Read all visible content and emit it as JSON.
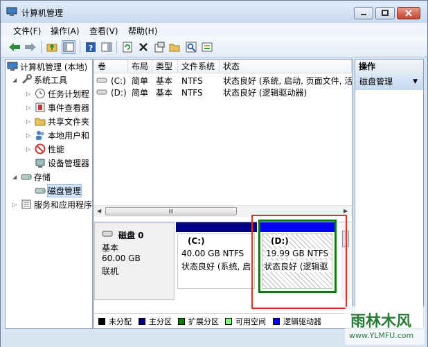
{
  "window": {
    "title": "计算机管理"
  },
  "menu": [
    "文件(F)",
    "操作(A)",
    "查看(V)",
    "帮助(H)"
  ],
  "tree": {
    "root": "计算机管理 (本地)",
    "system_tools": "系统工具",
    "items": [
      "任务计划程",
      "事件查看器",
      "共享文件夹",
      "本地用户和",
      "性能",
      "设备管理器"
    ],
    "storage": "存储",
    "disk_mgmt": "磁盘管理",
    "services": "服务和应用程序"
  },
  "volumes": {
    "columns": [
      "卷",
      "布局",
      "类型",
      "文件系统",
      "状态"
    ],
    "rows": [
      {
        "vol": "(C:)",
        "layout": "简单",
        "type": "基本",
        "fs": "NTFS",
        "status": "状态良好 (系统, 启动, 页面文件, 活"
      },
      {
        "vol": "(D:)",
        "layout": "简单",
        "type": "基本",
        "fs": "NTFS",
        "status": "状态良好 (逻辑驱动器)"
      }
    ],
    "scroll_grip": "III"
  },
  "disk": {
    "name": "磁盘 0",
    "kind": "基本",
    "size": "60.00 GB",
    "state": "联机",
    "partitions": [
      {
        "label": "(C:)",
        "size": "40.00 GB NTFS",
        "status": "状态良好 (系统, 启"
      },
      {
        "label": "(D:)",
        "size": "19.99 GB NTFS",
        "status": "状态良好 (逻辑驱"
      }
    ]
  },
  "legend": [
    {
      "label": "未分配",
      "color": "#000000"
    },
    {
      "label": "主分区",
      "color": "#00007f"
    },
    {
      "label": "扩展分区",
      "color": "#008000"
    },
    {
      "label": "可用空间",
      "color": "#80ff80"
    },
    {
      "label": "逻辑驱动器",
      "color": "#0000ff"
    }
  ],
  "actions": {
    "header": "操作",
    "item": "磁盘管理"
  },
  "watermark": {
    "main": "雨林木风",
    "url": "www.YLMFU.com"
  }
}
